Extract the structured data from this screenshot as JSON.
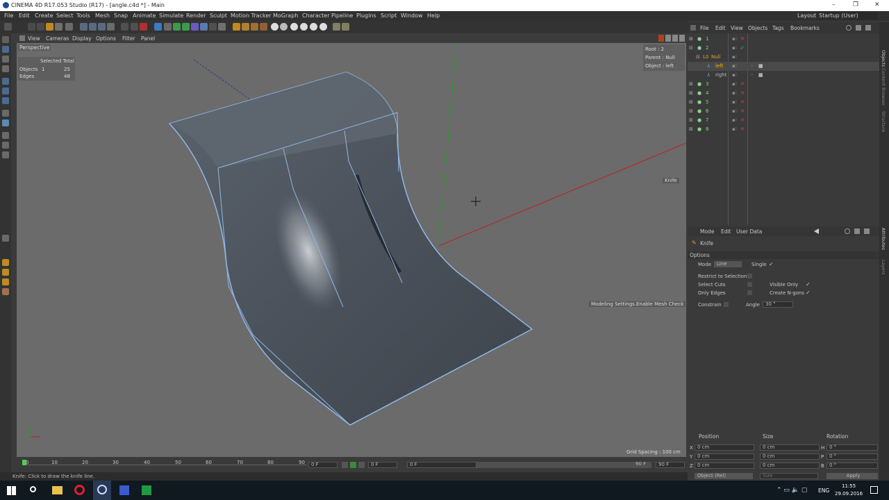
{
  "window": {
    "title": "CINEMA 4D R17.053 Studio (R17) - [angle.c4d *] - Main",
    "controls": [
      "–",
      "❐",
      "✕"
    ]
  },
  "menu": [
    "File",
    "Edit",
    "Create",
    "Select",
    "Tools",
    "Mesh",
    "Snap",
    "Animate",
    "Simulate",
    "Render",
    "Sculpt",
    "Motion Tracker",
    "MoGraph",
    "Character",
    "Pipeline",
    "Plugins",
    "Script",
    "Window",
    "Help"
  ],
  "layout": {
    "label": "Layout:",
    "value": "Startup (User)"
  },
  "viewport": {
    "menu": [
      "View",
      "Cameras",
      "Display",
      "Options",
      "Filter",
      "Panel"
    ],
    "label": "Perspective",
    "hud_header": "Selected Total",
    "hud_rows": [
      {
        "label": "Objects",
        "sel": "1",
        "total": "25"
      },
      {
        "label": "Edges",
        "sel": "",
        "total": "48"
      }
    ],
    "info": [
      "Root : 2",
      "Parent : Null",
      "Object : left"
    ],
    "knife_tip": "Knife",
    "mesh_check": "Modeling Settings.Enable Mesh Check",
    "grid": "Grid Spacing : 100 cm"
  },
  "timeline": {
    "ticks": [
      "0",
      "10",
      "20",
      "30",
      "40",
      "50",
      "60",
      "70",
      "80",
      "90"
    ],
    "start": "0 F",
    "current": "0 F",
    "range_start": "0 F",
    "range_end": "90 F",
    "end": "90 F"
  },
  "status": "Knife: Click to draw the knife line.",
  "objects": {
    "menu": [
      "File",
      "Edit",
      "View",
      "Objects",
      "Tags",
      "Bookmarks"
    ],
    "rows": [
      {
        "name": "1",
        "color": "#8fd08f"
      },
      {
        "name": "2",
        "color": "#8fd08f"
      },
      {
        "name": "Null",
        "color": "#e0a030"
      },
      {
        "name": "left",
        "color": "#ffb000"
      },
      {
        "name": "right",
        "color": "#bbbbbb"
      },
      {
        "name": "3",
        "color": "#8fd08f"
      },
      {
        "name": "4",
        "color": "#8fd08f"
      },
      {
        "name": "5",
        "color": "#8fd08f"
      },
      {
        "name": "6",
        "color": "#8fd08f"
      },
      {
        "name": "7",
        "color": "#8fd08f"
      },
      {
        "name": "8",
        "color": "#8fd08f"
      }
    ]
  },
  "attributes": {
    "menu": [
      "Mode",
      "Edit",
      "User Data"
    ],
    "tool": "Knife",
    "section": "Options",
    "mode_label": "Mode",
    "mode_value": "Line",
    "single_label": "Single",
    "restrict": "Restrict to Selection",
    "select_cuts": "Select Cuts",
    "visible_only": "Visible Only",
    "only_edges": "Only Edges",
    "create_ngons": "Create N-gons",
    "constrain": "Constrain",
    "angle_label": "Angle",
    "angle_value": "30 °"
  },
  "coords": {
    "headers": [
      "Position",
      "Size",
      "Rotation"
    ],
    "rows": [
      {
        "axis": "X",
        "pos": "0 cm",
        "size": "0 cm",
        "raxis": "H",
        "rot": "0 °"
      },
      {
        "axis": "Y",
        "pos": "0 cm",
        "size": "0 cm",
        "raxis": "P",
        "rot": "0 °"
      },
      {
        "axis": "Z",
        "pos": "0 cm",
        "size": "0 cm",
        "raxis": "B",
        "rot": "0 °"
      }
    ],
    "mode": "Object (Rel)",
    "size_mode": "Size",
    "apply": "Apply"
  },
  "right_tabs": [
    "Objects",
    "Content Browser",
    "Structure",
    "Attributes",
    "Layers"
  ],
  "taskbar": {
    "lang": "ENG",
    "time": "11:55",
    "date": "29.09.2016"
  },
  "colors": {
    "viewport_bg": "#6b6b6b",
    "panel_bg": "#3a3a3a",
    "axis_x": "#d02020",
    "axis_y": "#20a020",
    "accent": "#ffb000"
  }
}
